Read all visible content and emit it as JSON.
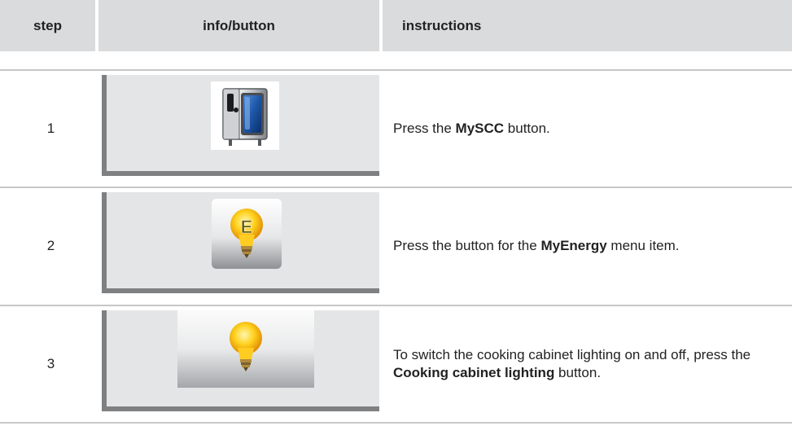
{
  "header": {
    "step": "step",
    "info": "info/button",
    "instructions": "instructions"
  },
  "steps": [
    {
      "number": "1",
      "icon": "oven-icon",
      "instr_pre": "Press the ",
      "instr_bold": "MySCC",
      "instr_post": " button."
    },
    {
      "number": "2",
      "icon": "energy-bulb-icon",
      "instr_pre": "Press the button for the ",
      "instr_bold": "MyEnergy",
      "instr_post": " menu item."
    },
    {
      "number": "3",
      "icon": "lightbulb-icon",
      "instr_pre": "To switch the cooking cabinet lighting on and off, press the ",
      "instr_bold": "Cooking cabinet lighting",
      "instr_post": " button."
    }
  ],
  "energy_letter": "E",
  "colors": {
    "header_bg": "#dadbdc",
    "panel_bg": "#e4e5e6",
    "panel_shadow": "#7f8081",
    "bulb_yellow": "#ffd21f",
    "door_blue": "#1d56a6"
  }
}
